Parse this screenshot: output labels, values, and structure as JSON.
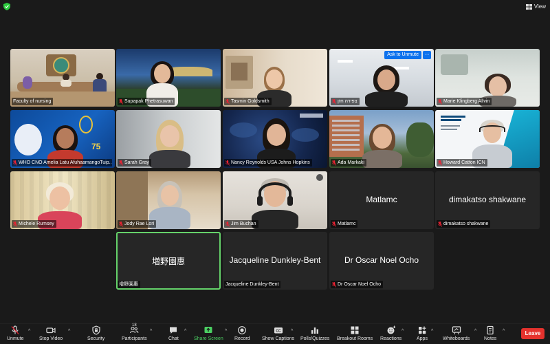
{
  "header": {
    "view_label": "View"
  },
  "ask_to_unmute": {
    "label": "Ask to Unmute",
    "more": "···"
  },
  "participants": [
    {
      "name": "Faculty of nursing",
      "muted": false,
      "video": true
    },
    {
      "name": "Supapak Phetrasuwan",
      "muted": true,
      "video": true
    },
    {
      "name": "Tasmin Goldsmith",
      "muted": true,
      "video": true
    },
    {
      "name": "צפירה חזן",
      "muted": true,
      "video": true
    },
    {
      "name": "Marie Klingberg Allvin",
      "muted": true,
      "video": true
    },
    {
      "name": "WHO CNO Amelia Latu AfuhaamangoTuip...",
      "muted": true,
      "video": true
    },
    {
      "name": "Sarah Gray",
      "muted": true,
      "video": true
    },
    {
      "name": "Nancy Reynolds USA Johns Hopkins",
      "muted": true,
      "video": true
    },
    {
      "name": "Ada Markaki",
      "muted": true,
      "video": true
    },
    {
      "name": "Howard Catton ICN",
      "muted": true,
      "video": true
    },
    {
      "name": "Michele Rumsey",
      "muted": true,
      "video": true
    },
    {
      "name": "Jody Rae Lori",
      "muted": true,
      "video": true
    },
    {
      "name": "Jim Buchan",
      "muted": true,
      "video": true
    },
    {
      "name": "Matlamc",
      "muted": true,
      "video": false
    },
    {
      "name": "dimakatso shakwane",
      "muted": true,
      "video": false
    },
    {
      "name": "増野園惠",
      "muted": false,
      "video": false
    },
    {
      "name": "Jacqueline Dunkley-Bent",
      "muted": false,
      "video": false
    },
    {
      "name": "Dr Oscar Noel Ocho",
      "muted": true,
      "video": false
    }
  ],
  "toolbar": {
    "unmute": "Unmute",
    "stop_video": "Stop Video",
    "security": "Security",
    "participants": "Participants",
    "participants_count": "18",
    "chat": "Chat",
    "share_screen": "Share Screen",
    "record": "Record",
    "show_captions": "Show Captions",
    "polls": "Polls/Quizzes",
    "breakout": "Breakout Rooms",
    "reactions": "Reactions",
    "apps": "Apps",
    "whiteboards": "Whiteboards",
    "notes": "Notes",
    "leave": "Leave"
  },
  "colors": {
    "accent_blue": "#0e72ed",
    "active_speaker": "#65d36a",
    "leave_red": "#e5322d",
    "share_green": "#4bd163"
  }
}
